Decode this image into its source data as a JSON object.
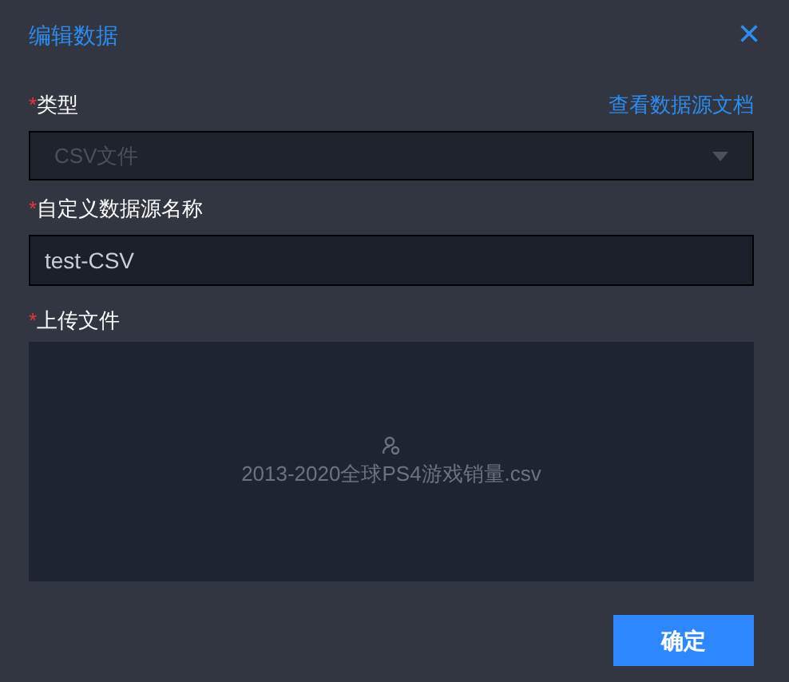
{
  "dialog": {
    "title": "编辑数据",
    "close_icon": "×"
  },
  "fields": [
    {
      "kind": "select",
      "label": "类型",
      "required_mark": "*",
      "value": "CSV文件",
      "disabled": true,
      "link": "查看数据源文档"
    },
    {
      "kind": "input",
      "label": "自定义数据源名称",
      "required_mark": "*",
      "value": "test-CSV"
    },
    {
      "kind": "upload",
      "label": "上传文件",
      "required_mark": "*",
      "file": "2013-2020全球PS4游戏销量.csv"
    }
  ],
  "buttons": [
    {
      "label": "确定"
    }
  ]
}
